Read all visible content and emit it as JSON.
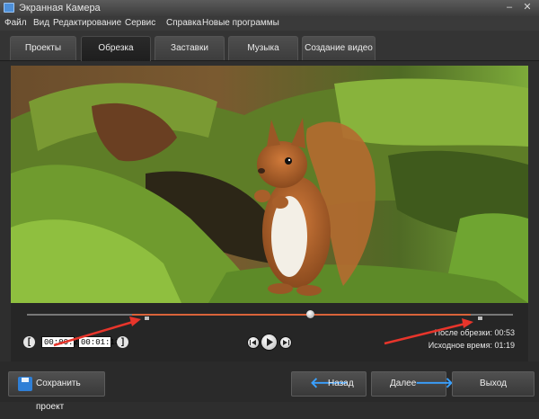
{
  "window": {
    "title": "Экранная Камера",
    "minimize_glyph": "–",
    "close_glyph": "✕"
  },
  "menu": [
    "Файл",
    "Вид",
    "Редактирование",
    "Сервис",
    "Справка",
    "Новые программы"
  ],
  "tabs": [
    {
      "label": "Проекты",
      "active": false
    },
    {
      "label": "Обрезка",
      "active": true
    },
    {
      "label": "Заставки",
      "active": false
    },
    {
      "label": "Музыка",
      "active": false
    },
    {
      "label": "Создание видео",
      "active": false
    }
  ],
  "player": {
    "preview_image": "squirrel-on-mossy-log",
    "progress_fraction": 0.58,
    "trim_start_fraction": 0.245,
    "trim_end_fraction": 0.94,
    "start_bracket_glyph": "[",
    "end_bracket_glyph": "]",
    "start_time": "00:00:20",
    "end_time": "00:01:13",
    "icons": {
      "prev": "skip-back-icon",
      "play": "play-icon",
      "next": "skip-forward-icon"
    },
    "after_trim_label": "После обрезки:",
    "after_trim_value": "00:53",
    "original_label": "Исходное время:",
    "original_value": "01:19"
  },
  "buttons": {
    "save_project": "Сохранить проект",
    "back": "Назад",
    "next": "Далее",
    "exit": "Выход",
    "back_arrow": "🡐",
    "next_arrow": "🡒"
  },
  "colors": {
    "accent": "#d9633a",
    "annotation_arrow": "#e8352b",
    "nav_arrow": "#3aa0ff"
  }
}
